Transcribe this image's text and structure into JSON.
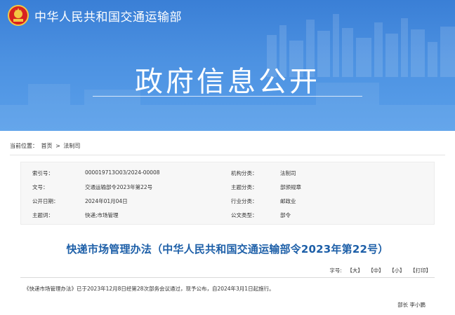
{
  "header": {
    "ministry_name": "中华人民共和国交通运输部",
    "section_title": "政府信息公开",
    "banner_color": "#4a8fe0"
  },
  "breadcrumb": {
    "label": "当前位置：",
    "home": "首页",
    "separator": ">",
    "current": "法制司"
  },
  "meta": [
    {
      "label1": "索引号：",
      "value1": "000019713O03/2024-00008",
      "label2": "机构分类：",
      "value2": "法制司"
    },
    {
      "label1": "文号：",
      "value1": "交通运输部令2023年第22号",
      "label2": "主题分类：",
      "value2": "部颁规章"
    },
    {
      "label1": "公开日期：",
      "value1": "2024年01月04日",
      "label2": "行业分类：",
      "value2": "邮政业"
    },
    {
      "label1": "主题词：",
      "value1": "快递;市场管理",
      "label2": "公文类型：",
      "value2": "部令"
    }
  ],
  "document": {
    "title": "快递市场管理办法（中华人民共和国交通运输部令2023年第22号）",
    "title_color": "#1d5fa8",
    "font_size_label": "字号:",
    "font_large": "【大】",
    "font_medium": "【中】",
    "font_small": "【小】",
    "print_label": "【打印】",
    "body": "《快递市场管理办法》已于2023年12月8日经第28次部务会议通过，现予公布，自2024年3月1日起施行。",
    "signature": "部长  李小鹏"
  }
}
